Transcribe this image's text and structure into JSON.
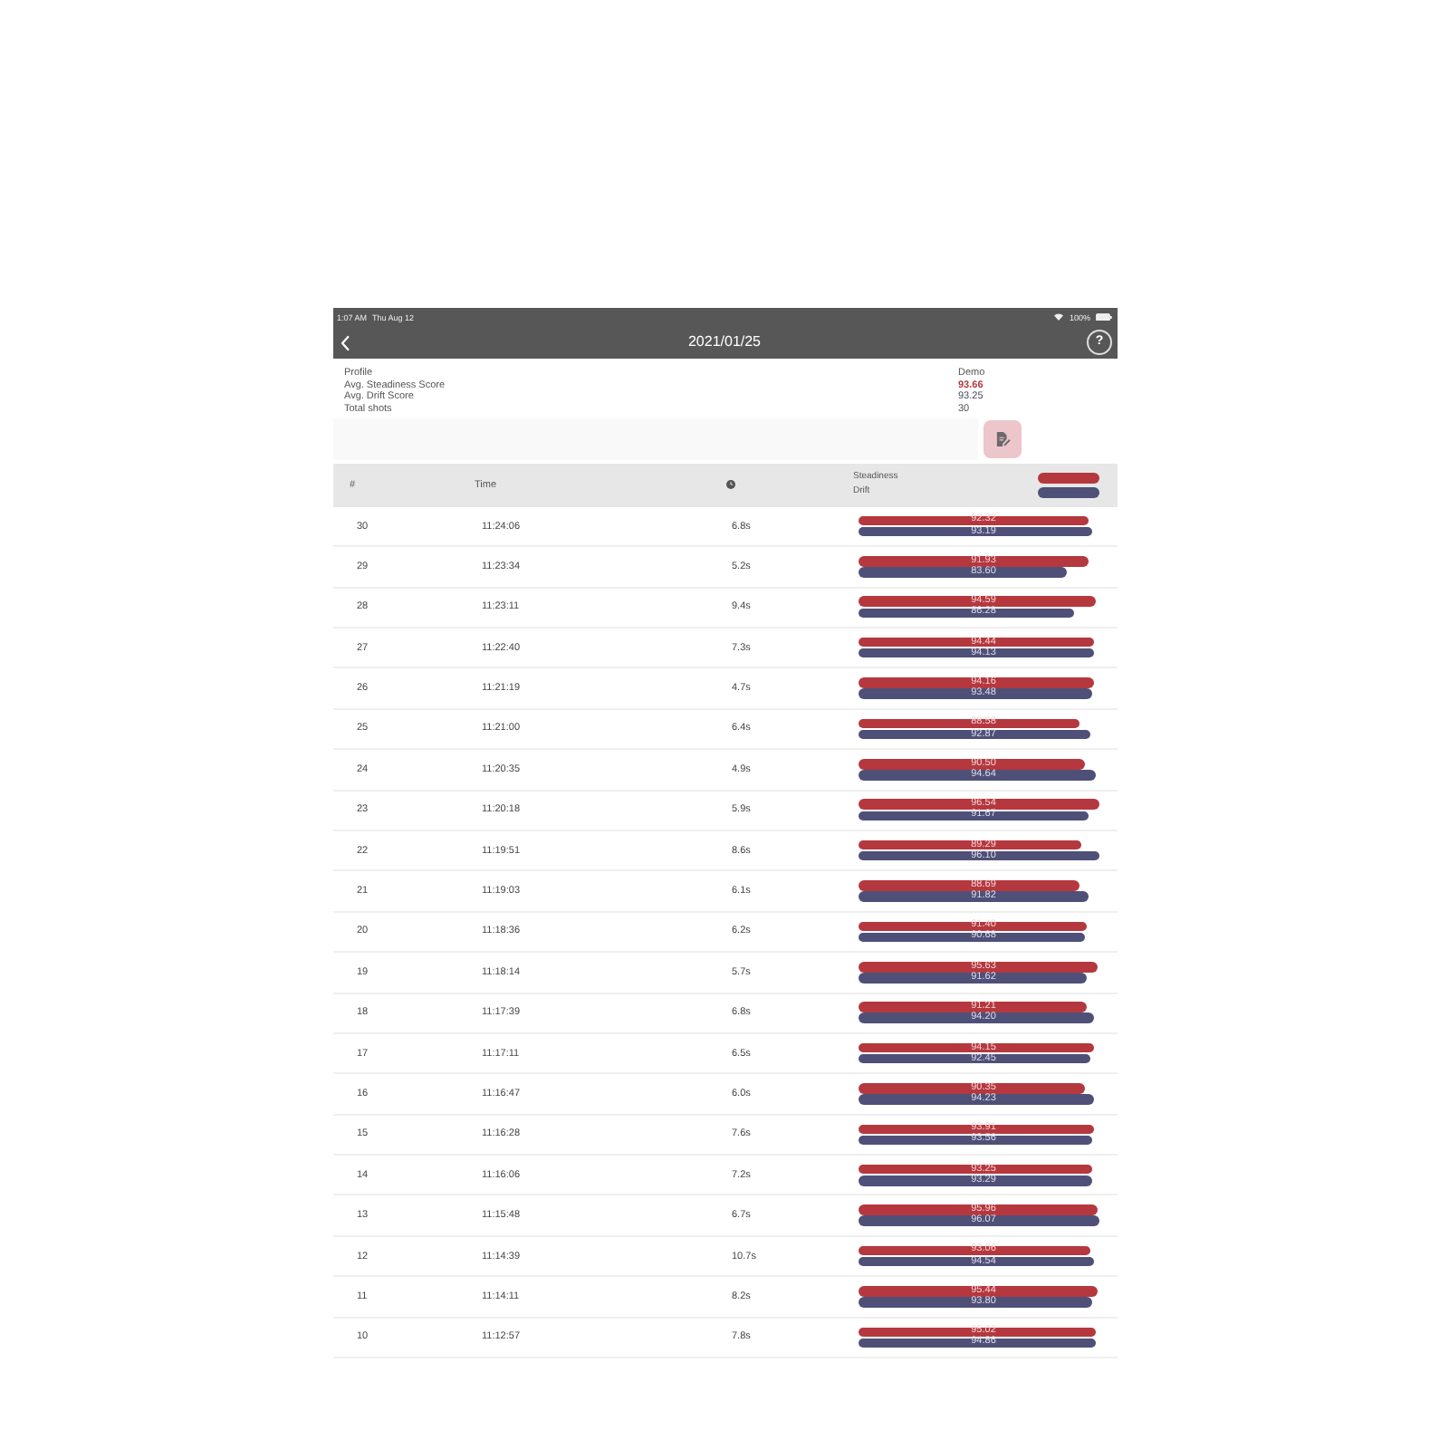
{
  "status_bar": {
    "time": "1:07 AM",
    "date": "Thu Aug 12",
    "battery": "100%"
  },
  "header": {
    "title": "2021/01/25",
    "help_button": "?"
  },
  "summary": [
    {
      "label": "Profile",
      "value": "Demo",
      "kind": "text"
    },
    {
      "label": "Avg. Steadiness Score",
      "value": "93.66",
      "kind": "steadiness"
    },
    {
      "label": "Avg. Drift Score",
      "value": "93.25",
      "kind": "drift"
    },
    {
      "label": "Total shots",
      "value": "30",
      "kind": "text"
    }
  ],
  "table": {
    "columns": [
      {
        "kind": "text",
        "label": "#"
      },
      {
        "kind": "text",
        "label": "Time"
      },
      {
        "kind": "icon"
      }
    ],
    "legend": [
      {
        "label": "Steadiness",
        "color": "#b5383e"
      },
      {
        "label": "Drift",
        "color": "#4f5078"
      }
    ],
    "rows": [
      {
        "number": "30",
        "time": "11:24:06",
        "duration": "6.8s",
        "scores": [
          {
            "value": "92.32",
            "level": 0.9232
          },
          {
            "value": "93.19",
            "level": 0.9319
          }
        ]
      },
      {
        "number": "29",
        "time": "11:23:34",
        "duration": "5.2s",
        "scores": [
          {
            "value": "91.93",
            "level": 0.9193
          },
          {
            "value": "83.60",
            "level": 0.836
          }
        ]
      },
      {
        "number": "28",
        "time": "11:23:11",
        "duration": "9.4s",
        "scores": [
          {
            "value": "94.59",
            "level": 0.9459
          },
          {
            "value": "86.28",
            "level": 0.8628
          }
        ]
      },
      {
        "number": "27",
        "time": "11:22:40",
        "duration": "7.3s",
        "scores": [
          {
            "value": "94.44",
            "level": 0.9444
          },
          {
            "value": "94.13",
            "level": 0.9413
          }
        ]
      },
      {
        "number": "26",
        "time": "11:21:19",
        "duration": "4.7s",
        "scores": [
          {
            "value": "94.16",
            "level": 0.9416
          },
          {
            "value": "93.48",
            "level": 0.9348
          }
        ]
      },
      {
        "number": "25",
        "time": "11:21:00",
        "duration": "6.4s",
        "scores": [
          {
            "value": "88.58",
            "level": 0.8858
          },
          {
            "value": "92.87",
            "level": 0.9287
          }
        ]
      },
      {
        "number": "24",
        "time": "11:20:35",
        "duration": "4.9s",
        "scores": [
          {
            "value": "90.50",
            "level": 0.905
          },
          {
            "value": "94.64",
            "level": 0.9464
          }
        ]
      },
      {
        "number": "23",
        "time": "11:20:18",
        "duration": "5.9s",
        "scores": [
          {
            "value": "96.54",
            "level": 0.9654
          },
          {
            "value": "91.67",
            "level": 0.9167
          }
        ]
      },
      {
        "number": "22",
        "time": "11:19:51",
        "duration": "8.6s",
        "scores": [
          {
            "value": "89.29",
            "level": 0.8929
          },
          {
            "value": "96.10",
            "level": 0.961
          }
        ]
      },
      {
        "number": "21",
        "time": "11:19:03",
        "duration": "6.1s",
        "scores": [
          {
            "value": "88.69",
            "level": 0.8869
          },
          {
            "value": "91.82",
            "level": 0.9182
          }
        ]
      },
      {
        "number": "20",
        "time": "11:18:36",
        "duration": "6.2s",
        "scores": [
          {
            "value": "91.40",
            "level": 0.914
          },
          {
            "value": "90.68",
            "level": 0.9068
          }
        ]
      },
      {
        "number": "19",
        "time": "11:18:14",
        "duration": "5.7s",
        "scores": [
          {
            "value": "95.63",
            "level": 0.9563
          },
          {
            "value": "91.62",
            "level": 0.9162
          }
        ]
      },
      {
        "number": "18",
        "time": "11:17:39",
        "duration": "6.8s",
        "scores": [
          {
            "value": "91.21",
            "level": 0.9121
          },
          {
            "value": "94.20",
            "level": 0.942
          }
        ]
      },
      {
        "number": "17",
        "time": "11:17:11",
        "duration": "6.5s",
        "scores": [
          {
            "value": "94.15",
            "level": 0.9415
          },
          {
            "value": "92.45",
            "level": 0.9245
          }
        ]
      },
      {
        "number": "16",
        "time": "11:16:47",
        "duration": "6.0s",
        "scores": [
          {
            "value": "90.35",
            "level": 0.9035
          },
          {
            "value": "94.23",
            "level": 0.9423
          }
        ]
      },
      {
        "number": "15",
        "time": "11:16:28",
        "duration": "7.6s",
        "scores": [
          {
            "value": "93.91",
            "level": 0.9391
          },
          {
            "value": "93.56",
            "level": 0.9356
          }
        ]
      },
      {
        "number": "14",
        "time": "11:16:06",
        "duration": "7.2s",
        "scores": [
          {
            "value": "93.25",
            "level": 0.9325
          },
          {
            "value": "93.29",
            "level": 0.9329
          }
        ]
      },
      {
        "number": "13",
        "time": "11:15:48",
        "duration": "6.7s",
        "scores": [
          {
            "value": "95.96",
            "level": 0.9596
          },
          {
            "value": "96.07",
            "level": 0.9607
          }
        ]
      },
      {
        "number": "12",
        "time": "11:14:39",
        "duration": "10.7s",
        "scores": [
          {
            "value": "93.06",
            "level": 0.9306
          },
          {
            "value": "94.54",
            "level": 0.9454
          }
        ]
      },
      {
        "number": "11",
        "time": "11:14:11",
        "duration": "8.2s",
        "scores": [
          {
            "value": "95.44",
            "level": 0.9544
          },
          {
            "value": "93.80",
            "level": 0.938
          }
        ]
      },
      {
        "number": "10",
        "time": "11:12:57",
        "duration": "7.8s",
        "scores": [
          {
            "value": "95.02",
            "level": 0.9502
          },
          {
            "value": "94.86",
            "level": 0.9486
          }
        ]
      }
    ]
  }
}
